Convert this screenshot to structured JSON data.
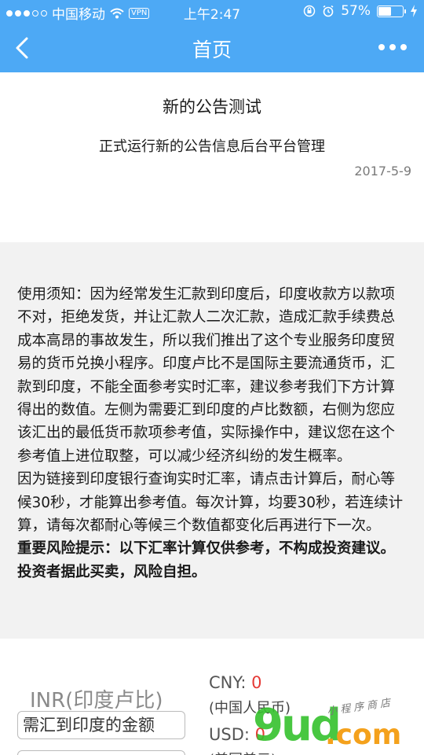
{
  "status_bar": {
    "carrier": "中国移动",
    "vpn": "VPN",
    "time": "上午2:47",
    "battery": "57%",
    "battery_level": 0.57,
    "icons": [
      "signal-dots",
      "wifi-icon",
      "lock-rotation-icon",
      "alarm-icon",
      "charging-icon"
    ]
  },
  "nav": {
    "title": "首页",
    "back_icon": "chevron-left-icon",
    "more_icon": "more-dots-icon"
  },
  "notice": {
    "title": "新的公告测试",
    "body": "正式运行新的公告信息后台平台管理",
    "date": "2017-5-9"
  },
  "instructions": {
    "paragraph1": "使用须知：因为经常发生汇款到印度后，印度收款方以款项不对，拒绝发货，并让汇款人二次汇款，造成汇款手续费总成本高昂的事故发生，所以我们推出了这个专业服务印度贸易的货币兑换小程序。印度卢比不是国际主要流通货币，汇款到印度，不能全面参考实时汇率，建议参考我们下方计算得出的数值。左侧为需要汇到印度的卢比数额，右侧为您应该汇出的最低货币款项参考值，实际操作中，建议您在这个参考值上进位取整，可以减少经济纠纷的发生概率。",
    "paragraph2": "因为链接到印度银行查询实时汇率，请点击计算后，耐心等候30秒，才能算出参考值。每次计算，均要30秒，若连续计算，请每次都耐心等候三个数值都变化后再进行下一次。",
    "risk": "重要风险提示：以下汇率计算仅供参考，不构成投资建议。投资者据此买卖，风险自担。"
  },
  "calculator": {
    "inr_label": "INR(印度卢比)",
    "amount_placeholder": "需汇到印度的金额",
    "cny_label": "CNY: ",
    "cny_value": "0",
    "cny_sub": "(中国人民币)",
    "usd_label": "USD: ",
    "usd_value": "0",
    "usd_sub": "(美国美元)"
  },
  "watermark": {
    "main": "9ud",
    "com": ".com",
    "small": "小程序商店"
  },
  "colors": {
    "header": "#4da9f5",
    "value_red": "#e53935",
    "panel_bg": "#f2f2f2"
  }
}
